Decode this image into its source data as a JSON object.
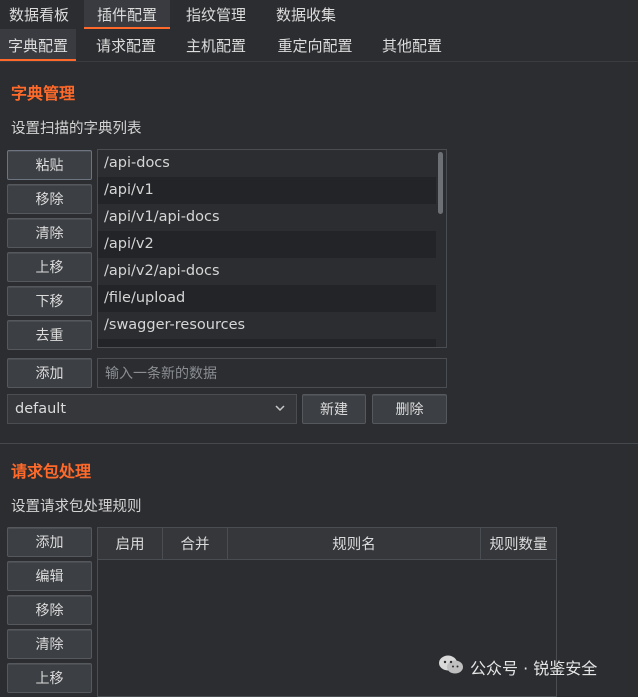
{
  "top_tabs": [
    "数据看板",
    "插件配置",
    "指纹管理",
    "数据收集"
  ],
  "sub_tabs": [
    "字典配置",
    "请求配置",
    "主机配置",
    "重定向配置",
    "其他配置"
  ],
  "dict": {
    "title": "字典管理",
    "desc": "设置扫描的字典列表",
    "buttons": [
      "粘贴",
      "移除",
      "清除",
      "上移",
      "下移",
      "去重"
    ],
    "items": [
      "/api-docs",
      "/api/v1",
      "/api/v1/api-docs",
      "/api/v2",
      "/api/v2/api-docs",
      "/file/upload",
      "/swagger-resources"
    ],
    "add_label": "添加",
    "input_placeholder": "输入一条新的数据",
    "select_value": "default",
    "new_label": "新建",
    "delete_label": "删除"
  },
  "request": {
    "title": "请求包处理",
    "desc": "设置请求包处理规则",
    "buttons": [
      "添加",
      "编辑",
      "移除",
      "清除",
      "上移"
    ],
    "columns": [
      "启用",
      "合并",
      "规则名",
      "规则数量"
    ]
  },
  "watermark": "公众号 · 锐鉴安全",
  "colors": {
    "accent": "#ff6a2a",
    "background": "#2b2d30"
  }
}
